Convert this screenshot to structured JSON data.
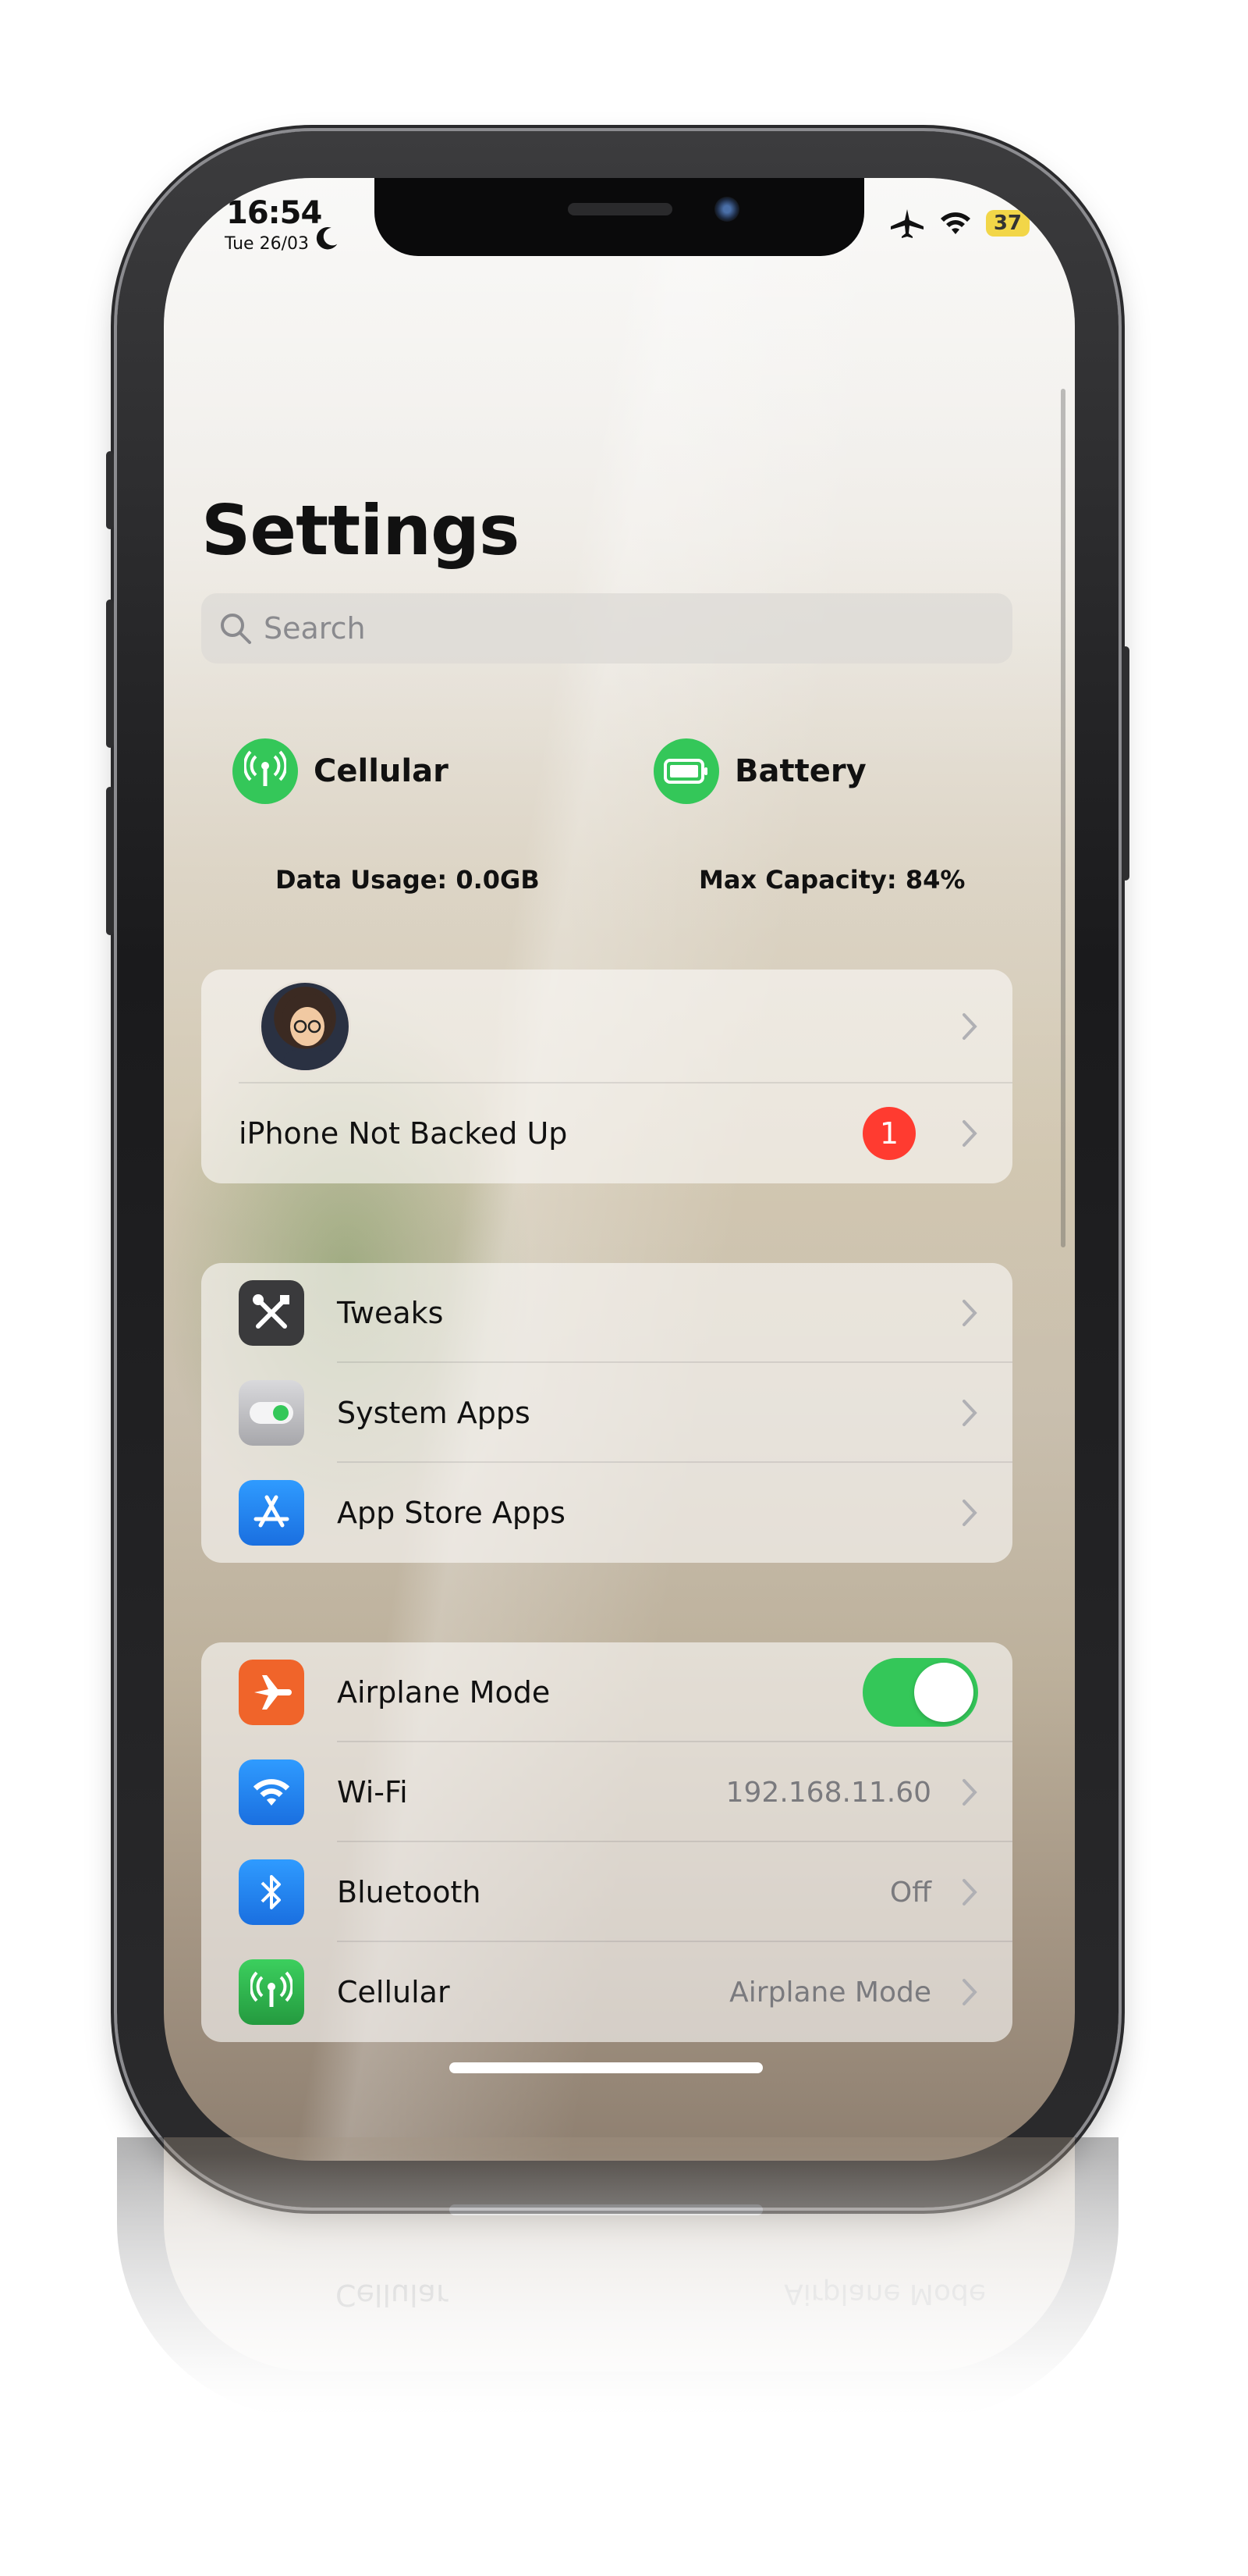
{
  "status_bar": {
    "time": "16:54",
    "date": "Tue 26/03",
    "battery_level": "37",
    "icons": [
      "moon-icon",
      "airplane-icon",
      "wifi-icon",
      "battery-icon"
    ]
  },
  "header": {
    "title": "Settings"
  },
  "search": {
    "placeholder": "Search"
  },
  "widgets": {
    "cellular": {
      "title": "Cellular",
      "value": "Data Usage: 0.0GB",
      "icon": "antenna-icon",
      "color": "#34c759"
    },
    "battery": {
      "title": "Battery",
      "value": "Max Capacity: 84%",
      "icon": "battery-icon",
      "color": "#34c759"
    }
  },
  "account_group": {
    "backup_label": "iPhone Not Backed Up",
    "badge_count": "1"
  },
  "apps_group": [
    {
      "label": "Tweaks",
      "icon": "tools-icon",
      "color": "#3a3a3c"
    },
    {
      "label": "System Apps",
      "icon": "toggle-icon",
      "color": "#8e8e93"
    },
    {
      "label": "App Store Apps",
      "icon": "app-store-icon",
      "color": "#1a7cf0"
    }
  ],
  "connectivity_group": [
    {
      "label": "Airplane Mode",
      "icon": "airplane-icon",
      "color": "#f0642a",
      "toggle_on": true
    },
    {
      "label": "Wi-Fi",
      "value": "192.168.11.60",
      "icon": "wifi-icon",
      "color": "#1a7cf0"
    },
    {
      "label": "Bluetooth",
      "value": "Off",
      "icon": "bluetooth-icon",
      "color": "#1a7cf0"
    },
    {
      "label": "Cellular",
      "value": "Airplane Mode",
      "icon": "antenna-icon",
      "color": "#30b94f"
    }
  ],
  "colors": {
    "accent_green": "#34c759",
    "badge_red": "#ff3b30"
  }
}
